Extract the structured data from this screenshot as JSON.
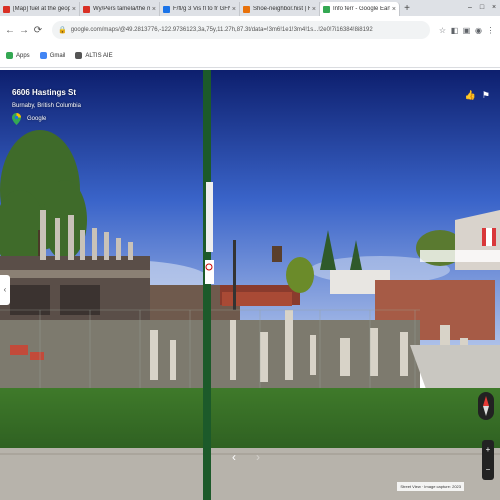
{
  "tabs": [
    {
      "title": "[Map] fuel at the geopo",
      "active": false,
      "color": "#d93025"
    },
    {
      "title": "Wy/Pers tamela/the map of ap",
      "active": false,
      "color": "#d93025"
    },
    {
      "title": "F/fl/g 3 Vis fl to fr GFN VFE/",
      "active": false,
      "color": "#1a73e8"
    },
    {
      "title": "Shoe-neighbor.hist | Fotos",
      "active": false,
      "color": "#e8710a"
    },
    {
      "title": "Info ferr - Google Earth",
      "active": true,
      "color": "#34a853"
    }
  ],
  "toolbar": {
    "url": "google.com/maps/@49.2813776,-122.9736123,3a,75y,11.27h,87.3t/data=!3m6!1e1!3m4!1s...!2e0!7i16384!8i8192"
  },
  "bookmarks": [
    {
      "label": "Apps",
      "color": "#34a853"
    },
    {
      "label": "Gmail",
      "color": "#4285f4"
    },
    {
      "label": "ALTIS AIE",
      "color": "#555555"
    }
  ],
  "streetview": {
    "address": "6606 Hastings St",
    "city": "Burnaby, British Columbia",
    "brand": "Google",
    "footer": "Street View · Image capture: 2023"
  },
  "icons": {
    "back": "←",
    "forward": "→",
    "reload": "⟳",
    "star": "☆",
    "menu": "⋮",
    "minimize": "–",
    "maximize": "□",
    "close": "×",
    "thumb": "👍",
    "flag": "⚑",
    "left_panel": "‹",
    "chev_left": "‹",
    "chev_right": "›",
    "zoom_in": "+",
    "zoom_out": "−"
  }
}
